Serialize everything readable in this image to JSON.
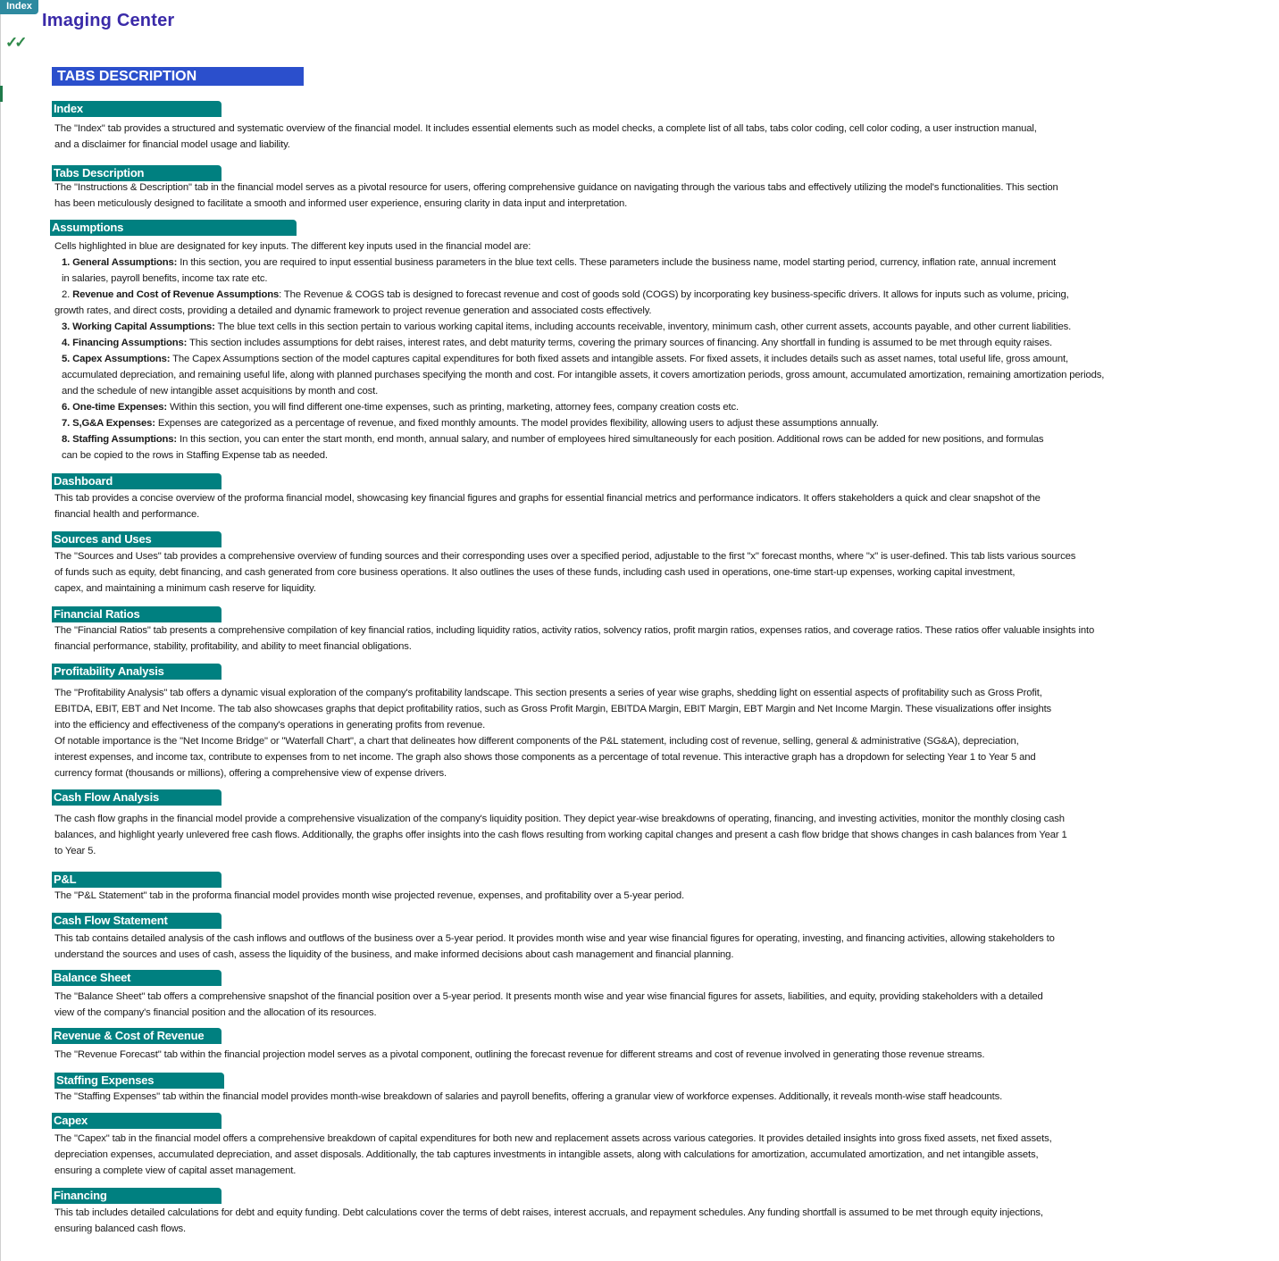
{
  "nav": {
    "index_button": "Index"
  },
  "header": {
    "title": "Imaging Center",
    "checks": "✓✓"
  },
  "banner": "TABS DESCRIPTION",
  "sections": [
    {
      "label": "Index",
      "lines": [
        "The \"Index\" tab provides a structured and systematic overview of the financial model. It includes essential elements such as model checks, a complete list of all tabs, tabs color coding, cell color coding, a user instruction manual,",
        "and a disclaimer for financial model usage and liability."
      ]
    },
    {
      "label": "Tabs Description",
      "lines": [
        "The \"Instructions & Description\" tab in the financial model serves as a pivotal resource for users, offering comprehensive guidance on navigating through the various tabs and effectively utilizing the model's functionalities. This section",
        "has been meticulously designed to facilitate a smooth and informed user experience, ensuring clarity in data input and interpretation."
      ]
    },
    {
      "label": "Assumptions",
      "intro": "Cells highlighted in blue are designated for key inputs. The different key inputs used in the financial model are:",
      "items": [
        {
          "title": "1. General Assumptions:",
          "lines": [
            " In this section, you are required to input essential business parameters in the blue text cells. These parameters include the business name, model starting period, currency, inflation rate, annual increment",
            "in salaries, payroll benefits, income tax rate etc."
          ]
        },
        {
          "prefix": "2. ",
          "title": "Revenue and Cost of Revenue Assumptions",
          "lines": [
            ": The Revenue & COGS tab is designed to forecast revenue and cost of goods sold (COGS) by incorporating key business-specific drivers. It allows for inputs such as volume, pricing,",
            "growth rates, and direct costs, providing a detailed and dynamic framework to project revenue generation and associated costs effectively."
          ]
        },
        {
          "title": "3. Working Capital Assumptions:",
          "lines": [
            " The blue text cells in this section pertain to various working capital items, including accounts receivable, inventory, minimum cash, other current assets, accounts payable,  and other current liabilities."
          ]
        },
        {
          "title": "4. Financing Assumptions:",
          "lines": [
            " This section includes assumptions for debt raises, interest rates, and debt maturity terms, covering the primary sources of financing. Any shortfall in funding is assumed to be met through equity raises."
          ]
        },
        {
          "title": "5. Capex Assumptions:",
          "lines": [
            " The Capex Assumptions section of the model captures capital expenditures for both fixed assets and intangible assets. For fixed assets, it includes details such as asset names, total useful life, gross amount,",
            "accumulated depreciation, and remaining useful life, along with planned purchases specifying the month and cost. For intangible assets, it covers amortization periods, gross amount, accumulated amortization, remaining amortization periods,",
            "and the schedule of new intangible asset acquisitions by month and cost."
          ]
        },
        {
          "title": "6. One-time Expenses:",
          "lines": [
            " Within this section, you will find different one-time expenses, such as printing, marketing, attorney fees, company creation costs etc."
          ]
        },
        {
          "title": "7. S,G&A Expenses:",
          "lines": [
            "  Expenses are categorized as a percentage  of revenue, and fixed monthly amounts. The model provides flexibility, allowing users to adjust these assumptions annually."
          ]
        },
        {
          "title": "8. Staffing Assumptions:",
          "lines": [
            " In this section, you can enter the start month, end month, annual salary, and number of employees hired simultaneously for each position. Additional rows can be added for new positions, and formulas",
            "can be copied to the rows in Staffing Expense tab as needed."
          ]
        }
      ]
    },
    {
      "label": "Dashboard",
      "lines": [
        "This tab provides a concise overview of the proforma financial model, showcasing key financial figures and graphs for essential financial metrics and performance indicators. It offers stakeholders a quick and clear snapshot of the",
        "financial health and performance."
      ]
    },
    {
      "label": "Sources and Uses",
      "lines": [
        "The \"Sources and Uses\" tab provides a comprehensive overview of funding sources and their corresponding uses over a specified period, adjustable to the first \"x\" forecast months, where \"x\" is user-defined. This tab lists various sources",
        "of funds such as equity, debt financing, and cash generated from core business operations. It also outlines the uses of these funds, including cash used in operations, one-time start-up expenses, working capital investment,",
        "capex, and maintaining  a minimum cash reserve for liquidity."
      ]
    },
    {
      "label": "Financial Ratios",
      "lines": [
        "The \"Financial Ratios\" tab presents a comprehensive compilation of key financial ratios, including liquidity ratios, activity ratios, solvency ratios, profit margin ratios, expenses ratios, and coverage ratios. These ratios offer valuable insights into",
        "financial performance, stability, profitability, and ability to meet financial obligations."
      ]
    },
    {
      "label": "Profitability Analysis",
      "lines": [
        "The \"Profitability Analysis\" tab offers a dynamic visual exploration of the company's profitability landscape. This section presents a series of year wise graphs, shedding light on essential aspects of profitability such as Gross Profit,",
        "EBITDA, EBIT, EBT and Net Income. The tab also showcases graphs that depict profitability ratios, such as Gross Profit Margin, EBITDA Margin, EBIT Margin, EBT Margin and Net Income Margin. These visualizations offer insights",
        "into the efficiency and effectiveness of the company's operations in generating profits from revenue.",
        "Of notable importance is the \"Net Income Bridge\" or \"Waterfall Chart\", a chart that delineates how different components of the P&L statement, including cost of revenue, selling, general & administrative (SG&A), depreciation,",
        "interest expenses, and income tax, contribute to expenses from to net income. The graph also shows those components as a percentage of total revenue. This interactive graph has a dropdown for selecting Year 1 to Year 5 and",
        "currency format (thousands or millions), offering a comprehensive view of expense drivers."
      ]
    },
    {
      "label": "Cash Flow Analysis",
      "lines": [
        "The cash flow graphs in the financial model provide a comprehensive visualization of the company's liquidity position. They depict year-wise breakdowns of operating, financing, and investing activities, monitor the monthly closing cash",
        "balances, and highlight yearly unlevered free cash flows. Additionally, the graphs offer insights into the cash flows resulting from working capital changes and present a cash flow bridge that shows changes in cash balances from Year 1",
        "to Year 5."
      ]
    },
    {
      "label": "P&L",
      "lines": [
        "The \"P&L Statement\" tab in the proforma financial model provides month wise projected revenue, expenses, and profitability over a 5-year period."
      ]
    },
    {
      "label": "Cash Flow Statement",
      "lines": [
        "This tab contains detailed analysis of the cash inflows and outflows of the business over a 5-year period. It provides month wise and year wise financial figures for operating, investing, and financing activities, allowing stakeholders to",
        "understand the sources and uses of cash, assess the liquidity of the business, and make informed decisions about cash management and financial planning."
      ]
    },
    {
      "label": "Balance Sheet",
      "lines": [
        "The \"Balance Sheet\" tab offers a comprehensive snapshot of the financial position over a 5-year period. It presents month wise and year wise financial figures for assets, liabilities, and equity, providing stakeholders with a detailed",
        "view of the company's financial position and the allocation of its resources."
      ]
    },
    {
      "label": "Revenue & Cost of Revenue",
      "lines": [
        "The \"Revenue Forecast\" tab within the financial projection model serves as a pivotal component, outlining the forecast revenue for different streams and cost of revenue involved in generating those revenue streams."
      ]
    },
    {
      "label": "Staffing Expenses",
      "lines": [
        "The \"Staffing Expenses\" tab within the financial model provides month-wise breakdown of salaries and payroll benefits, offering  a granular view of workforce expenses. Additionally, it reveals month-wise staff headcounts."
      ]
    },
    {
      "label": "Capex",
      "lines": [
        "The \"Capex\" tab in the financial model offers a comprehensive breakdown of capital expenditures for both new and replacement assets across various categories. It provides detailed insights into gross fixed assets, net fixed assets,",
        "depreciation expenses, accumulated depreciation, and asset disposals. Additionally, the tab captures investments in intangible assets, along with calculations for amortization, accumulated amortization, and net intangible assets,",
        "ensuring a complete view of capital asset management."
      ]
    },
    {
      "label": "Financing",
      "lines": [
        "This tab includes detailed calculations for debt and equity funding. Debt calculations cover the terms of debt raises, interest accruals, and repayment schedules. Any funding shortfall is assumed to be met through equity injections,",
        "ensuring balanced cash flows."
      ]
    }
  ]
}
